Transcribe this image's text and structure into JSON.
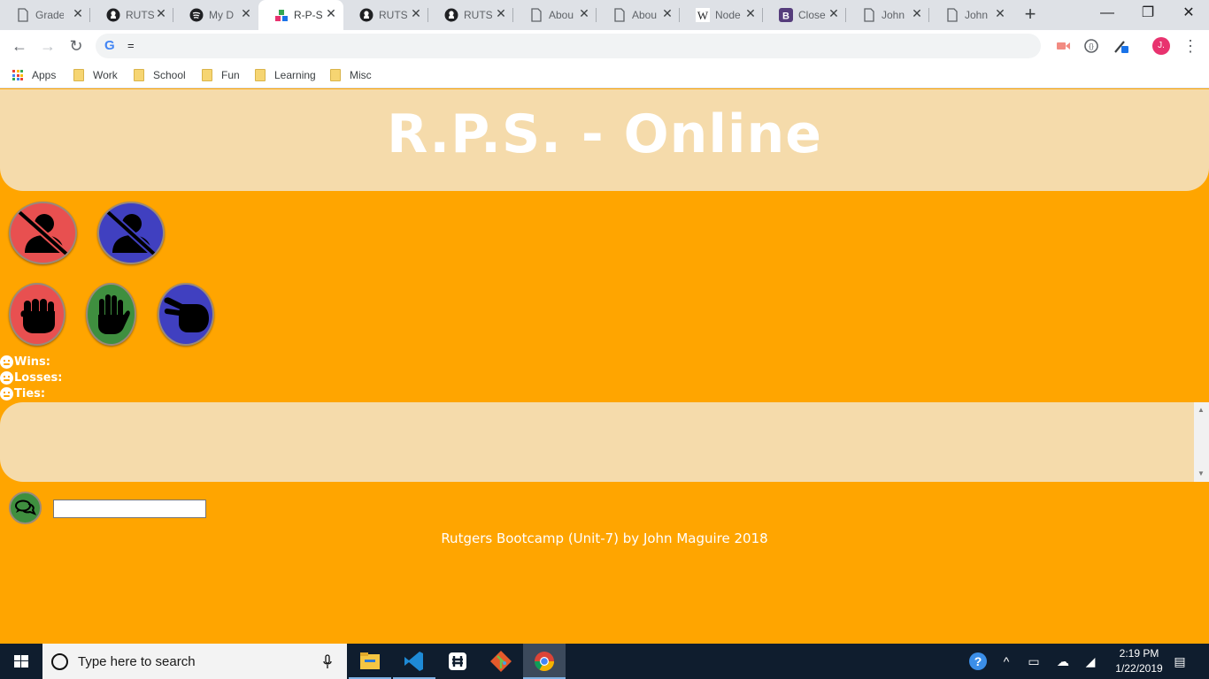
{
  "browser": {
    "tabs": [
      {
        "label": "Grade",
        "icon": "document-icon",
        "active": false
      },
      {
        "label": "RUTS",
        "icon": "github-icon",
        "active": false
      },
      {
        "label": "My D",
        "icon": "spotify-icon",
        "active": false
      },
      {
        "label": "R-P-S",
        "icon": "blocks-icon",
        "active": true
      },
      {
        "label": "RUTS",
        "icon": "github-icon",
        "active": false
      },
      {
        "label": "RUTS",
        "icon": "github-icon",
        "active": false
      },
      {
        "label": "Abou",
        "icon": "document-icon",
        "active": false
      },
      {
        "label": "Abou",
        "icon": "document-icon",
        "active": false
      },
      {
        "label": "Node",
        "icon": "wikipedia-icon",
        "active": false
      },
      {
        "label": "Close",
        "icon": "bootstrap-icon",
        "active": false
      },
      {
        "label": "John",
        "icon": "document-icon",
        "active": false
      },
      {
        "label": "John",
        "icon": "document-icon",
        "active": false
      }
    ],
    "new_tab_symbol": "+",
    "window_controls": {
      "minimize": "—",
      "maximize": "❐",
      "close": "✕"
    },
    "nav": {
      "back": "←",
      "forward": "→",
      "reload": "↻"
    },
    "omnibox_text": "=",
    "profile_initial": "J.",
    "menu_symbol": "⋮",
    "bookmarks": [
      {
        "label": "Apps",
        "type": "apps"
      },
      {
        "label": "Work",
        "type": "folder"
      },
      {
        "label": "School",
        "type": "folder"
      },
      {
        "label": "Fun",
        "type": "folder"
      },
      {
        "label": "Learning",
        "type": "folder"
      },
      {
        "label": "Misc",
        "type": "folder"
      }
    ]
  },
  "page": {
    "title": "R.P.S. - Online",
    "players": [
      {
        "name": "player-1",
        "color": "#e85050",
        "icon": "user-slash-icon"
      },
      {
        "name": "player-2",
        "color": "#4040c0",
        "icon": "user-slash-icon"
      }
    ],
    "choices": [
      {
        "name": "rock",
        "color": "#e85050",
        "icon": "fist-icon"
      },
      {
        "name": "paper",
        "color": "#3f8f3f",
        "icon": "open-hand-icon"
      },
      {
        "name": "scissors",
        "color": "#4040c0",
        "icon": "scissors-hand-icon"
      }
    ],
    "stats": {
      "wins_label": "Wins:",
      "losses_label": "Losses:",
      "ties_label": "Ties:"
    },
    "chat_input_value": "",
    "footer": "Rutgers Bootcamp (Unit-7) by John Maguire 2018",
    "colors": {
      "background": "#ffa500",
      "panel": "#f5dbab",
      "title": "#ffffff"
    }
  },
  "taskbar": {
    "search_placeholder": "Type here to search",
    "apps": [
      "file-explorer-icon",
      "vscode-icon",
      "slack-icon",
      "git-icon",
      "chrome-icon"
    ],
    "time": "2:19 PM",
    "date": "1/22/2019"
  }
}
